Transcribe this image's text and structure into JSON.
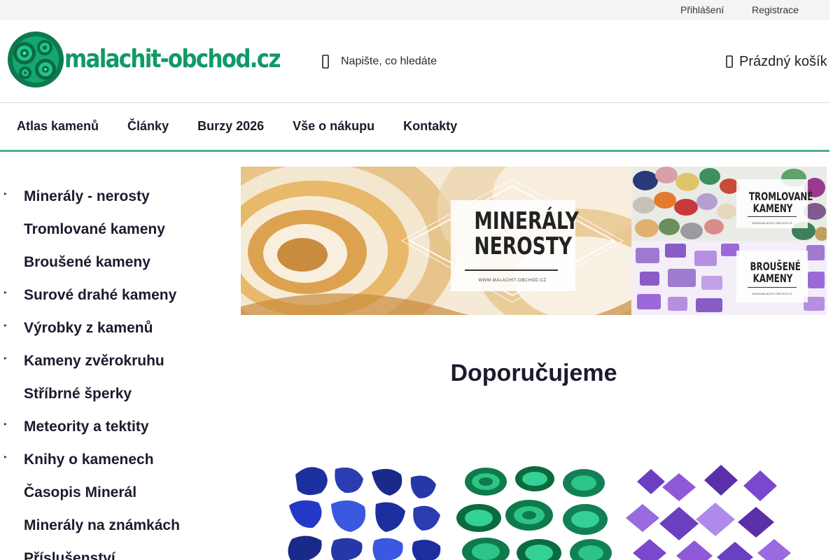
{
  "topbar": {
    "login_label": "Přihlášení",
    "register_label": "Registrace"
  },
  "header": {
    "logo_text": "malachit-obchod.cz",
    "search_placeholder": "Napište, co hledáte",
    "cart_label": "Prázdný košík"
  },
  "nav": {
    "items": [
      "Atlas kamenů",
      "Články",
      "Burzy 2026",
      "Vše o nákupu",
      "Kontakty"
    ]
  },
  "sidebar": {
    "items": [
      {
        "label": "Minerály - nerosty",
        "has_arrow": true
      },
      {
        "label": "Tromlované kameny",
        "has_arrow": false
      },
      {
        "label": "Broušené kameny",
        "has_arrow": false
      },
      {
        "label": "Surové drahé kameny",
        "has_arrow": true
      },
      {
        "label": "Výrobky z kamenů",
        "has_arrow": true
      },
      {
        "label": "Kameny zvěrokruhu",
        "has_arrow": true
      },
      {
        "label": "Stříbrné šperky",
        "has_arrow": false
      },
      {
        "label": "Meteority a tektity",
        "has_arrow": true
      },
      {
        "label": "Knihy o kamenech",
        "has_arrow": true
      },
      {
        "label": "Časopis Minerál",
        "has_arrow": false
      },
      {
        "label": "Minerály na známkách",
        "has_arrow": false
      },
      {
        "label": "Příslušenství",
        "has_arrow": false
      }
    ]
  },
  "banners": {
    "main": {
      "title_line1": "Minerály",
      "title_line2": "nerosty",
      "url": "WWW.MALACHIT-OBCHOD.CZ"
    },
    "side1": {
      "title_line1": "Tromlované",
      "title_line2": "kameny",
      "url": "WWW.MALACHIT-OBCHOD.CZ"
    },
    "side2": {
      "title_line1": "Broušené",
      "title_line2": "kameny",
      "url": "WWW.MALACHIT-OBCHOD.CZ"
    }
  },
  "section": {
    "title": "Doporučujeme"
  },
  "colors": {
    "accent": "#4fae8d",
    "logo_green": "#0f9a66",
    "text": "#1b1b2e",
    "topbar_bg": "#f4f4f4"
  },
  "icons": {
    "search": "search-icon",
    "cart": "cart-icon",
    "arrow": "chevron-right-icon"
  }
}
